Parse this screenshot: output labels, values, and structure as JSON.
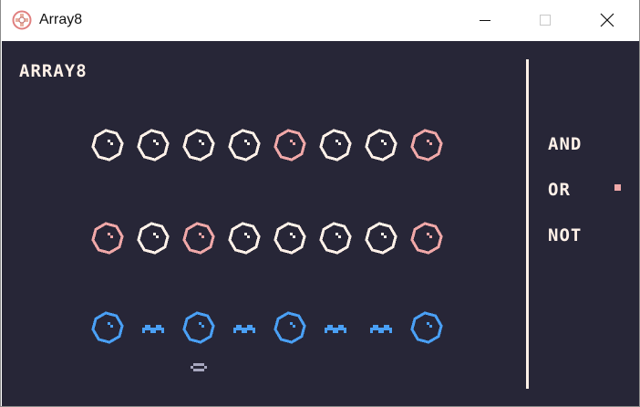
{
  "window": {
    "title": "Array8",
    "app_icon": "pico8-cart-icon",
    "controls": [
      "minimize-icon",
      "maximize-icon",
      "close-icon"
    ]
  },
  "game": {
    "heading": "ARRAY8",
    "colors": {
      "background": "#272637",
      "white": "#fff1e8",
      "pink": "#f0a8a8",
      "blue": "#4aa0f5",
      "divider": "#fff1e8",
      "cursor": "#a8a8c0",
      "selector": "#f0a8a8"
    },
    "rows": [
      {
        "name": "input-a",
        "cells": [
          "white",
          "white",
          "white",
          "white",
          "pink",
          "white",
          "white",
          "pink"
        ]
      },
      {
        "name": "input-b",
        "cells": [
          "pink",
          "white",
          "pink",
          "white",
          "white",
          "white",
          "white",
          "pink"
        ]
      },
      {
        "name": "output",
        "cells": [
          "blue",
          "wave",
          "blue",
          "wave",
          "blue",
          "wave",
          "wave",
          "blue"
        ]
      }
    ],
    "cursor_column": 1,
    "operations": [
      {
        "label": "AND",
        "selected": false
      },
      {
        "label": "OR",
        "selected": true
      },
      {
        "label": "NOT",
        "selected": false
      }
    ]
  }
}
